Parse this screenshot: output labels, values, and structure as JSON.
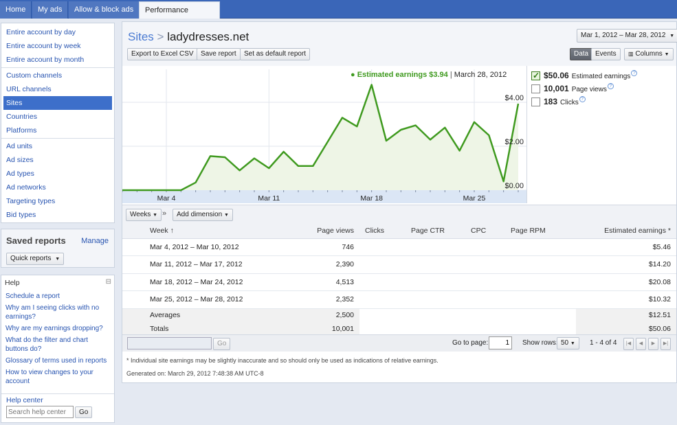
{
  "topnav": {
    "tabs": [
      {
        "label": "Home"
      },
      {
        "label": "My ads"
      },
      {
        "label": "Allow & block ads"
      },
      {
        "label": "Performance reports"
      }
    ]
  },
  "sidebar": {
    "group1": [
      {
        "label": "Entire account by day"
      },
      {
        "label": "Entire account by week"
      },
      {
        "label": "Entire account by month"
      }
    ],
    "group2": [
      {
        "label": "Custom channels"
      },
      {
        "label": "URL channels"
      },
      {
        "label": "Sites"
      },
      {
        "label": "Countries"
      },
      {
        "label": "Platforms"
      }
    ],
    "group3": [
      {
        "label": "Ad units"
      },
      {
        "label": "Ad sizes"
      },
      {
        "label": "Ad types"
      },
      {
        "label": "Ad networks"
      },
      {
        "label": "Targeting types"
      },
      {
        "label": "Bid types"
      }
    ],
    "selected": "Sites"
  },
  "saved_reports": {
    "title": "Saved reports",
    "manage": "Manage",
    "quick_reports": "Quick reports"
  },
  "help": {
    "title": "Help",
    "collapse": "⊟",
    "links": [
      "Schedule a report",
      "Why am I seeing clicks with no earnings?",
      "Why are my earnings dropping?",
      "What do the filter and chart buttons do?",
      "Glossary of terms used in reports",
      "How to view changes to your account"
    ],
    "center_label": "Help center",
    "search_placeholder": "Search help center",
    "go": "Go"
  },
  "header": {
    "crumb": "Sites",
    "separator": ">",
    "site": "ladydresses.net",
    "date_range": "Mar 1, 2012 – Mar 28, 2012",
    "buttons": {
      "export": "Export to Excel CSV",
      "save": "Save report",
      "default": "Set as default report",
      "data": "Data",
      "events": "Events",
      "columns": "Columns"
    }
  },
  "chart_tooltip": {
    "label": "Estimated earnings $3.94",
    "date": "March 28, 2012"
  },
  "metrics": [
    {
      "value": "$50.06",
      "name": "Estimated earnings",
      "checked": true
    },
    {
      "value": "10,001",
      "name": "Page views",
      "checked": false
    },
    {
      "value": "183",
      "name": "Clicks",
      "checked": false
    }
  ],
  "chart_data": {
    "type": "area",
    "series": [
      {
        "name": "Estimated earnings",
        "values": [
          0.0,
          0.0,
          0.0,
          0.0,
          0.0,
          0.35,
          1.55,
          1.5,
          0.9,
          1.45,
          1.0,
          1.75,
          1.1,
          1.1,
          2.2,
          3.3,
          2.9,
          4.8,
          2.25,
          2.75,
          2.95,
          2.3,
          2.85,
          1.8,
          3.1,
          2.5,
          0.4,
          3.94
        ]
      }
    ],
    "x_ticks": [
      "Mar 4",
      "Mar 11",
      "Mar 18",
      "Mar 25"
    ],
    "x_tick_days": [
      4,
      11,
      18,
      25
    ],
    "x_days": [
      1,
      28
    ],
    "y_ticks": [
      "$4.00",
      "$2.00",
      "$0.00"
    ],
    "y_tick_values": [
      4,
      2,
      0
    ],
    "ylim": [
      0,
      5.5
    ],
    "colors": {
      "line": "#3f9a1f",
      "fill": "#eef5e6",
      "grid": "#e2e6ec"
    }
  },
  "toolbar": {
    "weeks": "Weeks",
    "add_dimension": "Add dimension"
  },
  "table": {
    "headers": {
      "week": "Week ↑",
      "page_views": "Page views",
      "clicks": "Clicks",
      "ctr": "Page CTR",
      "cpc": "CPC",
      "rpm": "Page RPM",
      "earnings": "Estimated earnings *"
    },
    "rows": [
      {
        "week": "Mar 4, 2012 – Mar 10, 2012",
        "page_views": "746",
        "earnings": "$5.46"
      },
      {
        "week": "Mar 11, 2012 – Mar 17, 2012",
        "page_views": "2,390",
        "earnings": "$14.20"
      },
      {
        "week": "Mar 18, 2012 – Mar 24, 2012",
        "page_views": "4,513",
        "earnings": "$20.08"
      },
      {
        "week": "Mar 25, 2012 – Mar 28, 2012",
        "page_views": "2,352",
        "earnings": "$10.32"
      }
    ],
    "averages": {
      "label": "Averages",
      "page_views": "2,500",
      "earnings": "$12.51"
    },
    "totals": {
      "label": "Totals",
      "page_views": "10,001",
      "earnings": "$50.06"
    }
  },
  "pager": {
    "go": "Go",
    "goto_label": "Go to page:",
    "page": "1",
    "rows_label": "Show rows:",
    "rows_value": "50",
    "range": "1 - 4 of 4"
  },
  "footnote": "* Individual site earnings may be slightly inaccurate and so should only be used as indications of relative earnings.",
  "generated": "Generated on: March 29, 2012 7:48:38 AM UTC-8"
}
